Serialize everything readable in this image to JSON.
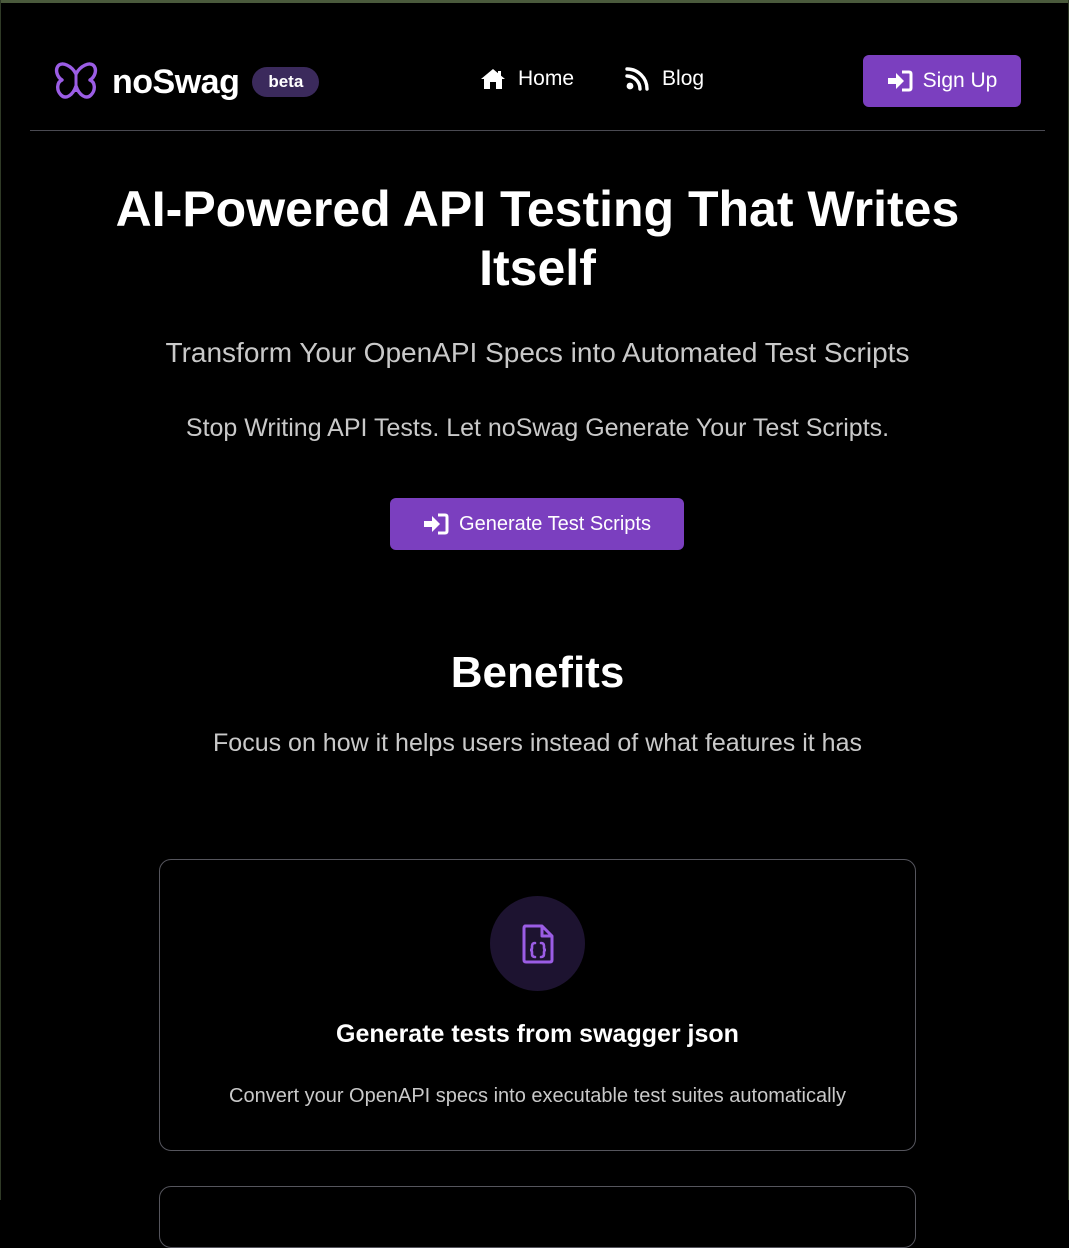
{
  "brand": {
    "name": "noSwag",
    "badge": "beta",
    "accent": "#7b3fbf"
  },
  "nav": {
    "links": [
      {
        "label": "Home",
        "icon": "home-icon"
      },
      {
        "label": "Blog",
        "icon": "rss-icon"
      }
    ],
    "signup_label": "Sign Up",
    "signup_icon": "sign-in-icon"
  },
  "hero": {
    "title": "AI-Powered API Testing That Writes Itself",
    "subtitle": "Transform Your OpenAPI Specs into Automated Test Scripts",
    "tagline": "Stop Writing API Tests. Let noSwag Generate Your Test Scripts.",
    "cta_label": "Generate Test Scripts",
    "cta_icon": "sign-in-icon"
  },
  "benefits": {
    "title": "Benefits",
    "subtitle": "Focus on how it helps users instead of what features it has",
    "cards": [
      {
        "icon": "file-code-icon",
        "title": "Generate tests from swagger json",
        "description": "Convert your OpenAPI specs into executable test suites automatically"
      }
    ]
  }
}
